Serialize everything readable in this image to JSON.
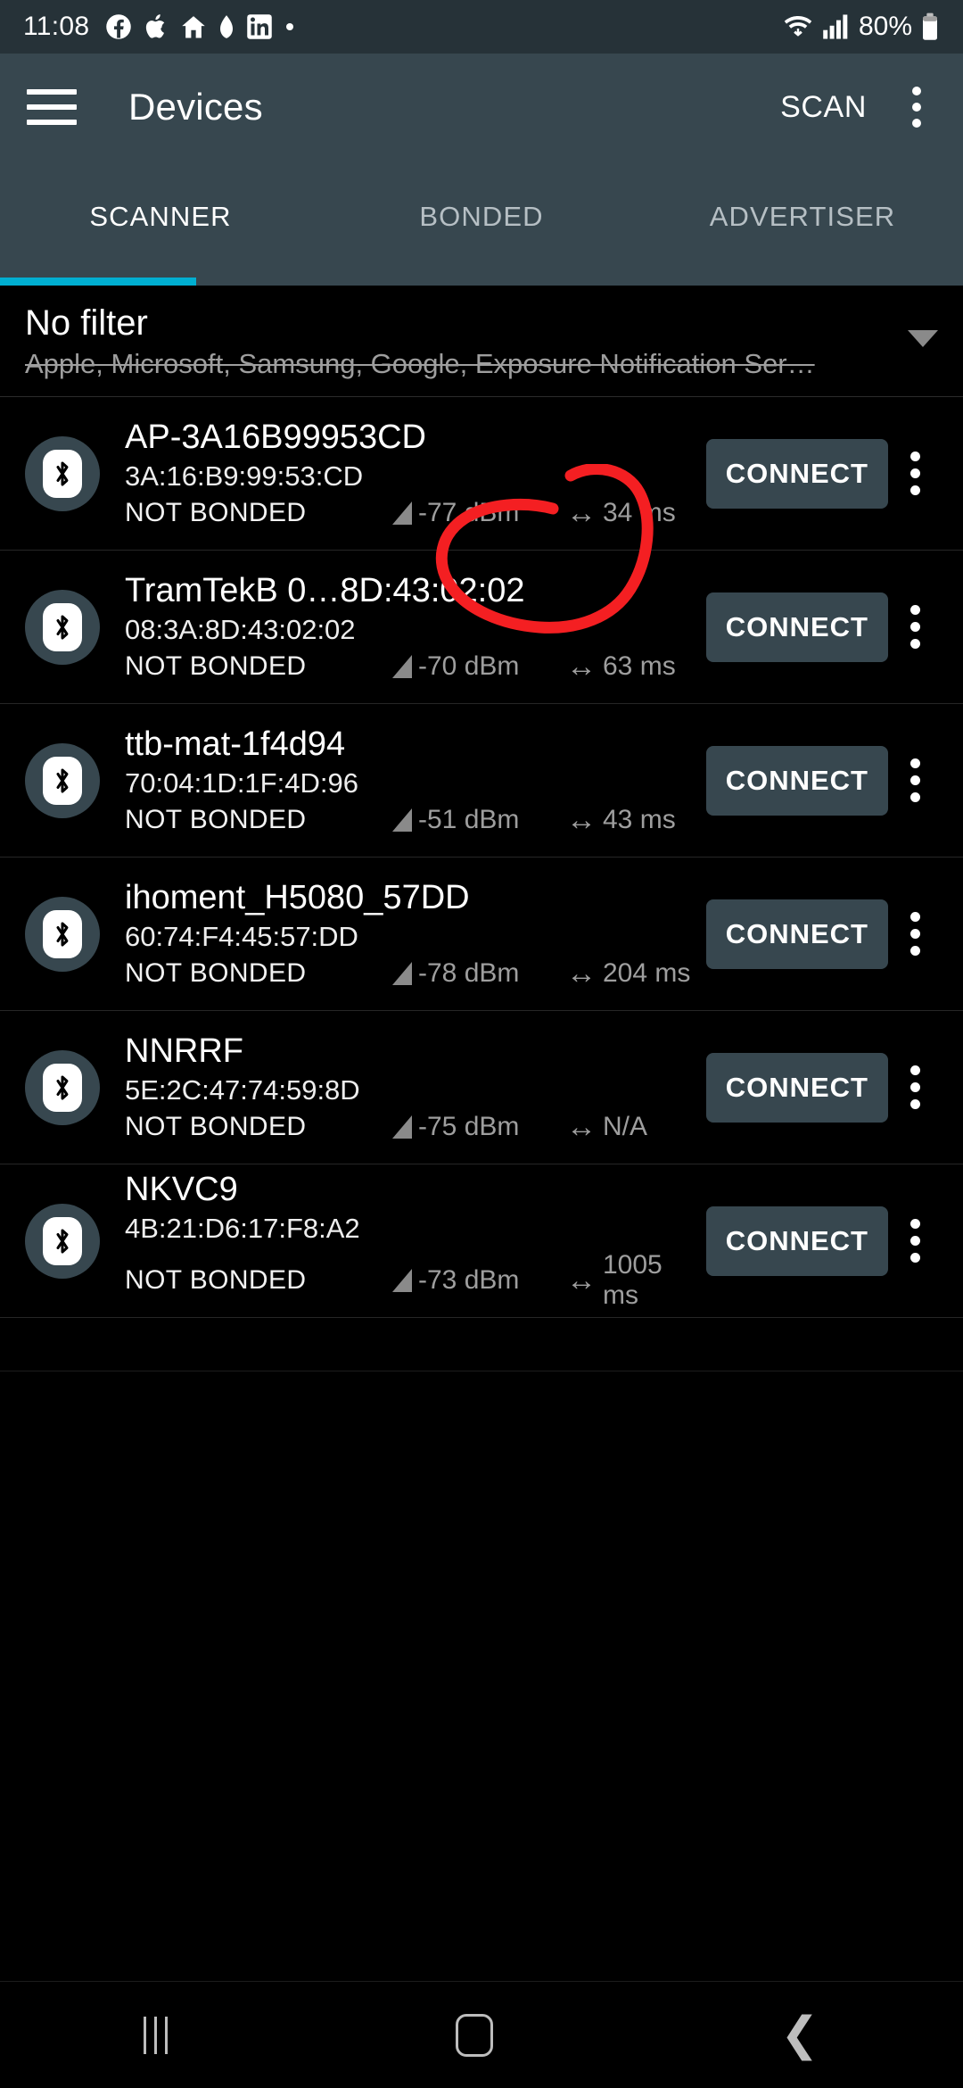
{
  "status_bar": {
    "time": "11:08",
    "left_icons": [
      "facebook-icon",
      "apple-icon",
      "home-icon",
      "leaf-icon",
      "linkedin-icon",
      "dot-icon"
    ],
    "right_icons": [
      "wifi-icon",
      "cellular-signal-icon",
      "battery-icon"
    ],
    "battery_percent": "80%",
    "background": "#263238"
  },
  "app_bar": {
    "menu_icon": "hamburger-menu-icon",
    "title": "Devices",
    "scan_label": "SCAN",
    "overflow_icon": "more-vertical-icon",
    "background": "#37474F"
  },
  "tabs": {
    "items": [
      {
        "label": "SCANNER",
        "active": true
      },
      {
        "label": "BONDED",
        "active": false
      },
      {
        "label": "ADVERTISER",
        "active": false
      }
    ],
    "indicator_color": "#00AFD1"
  },
  "filter": {
    "title": "No filter",
    "subtitle": "Apple, Microsoft, Samsung, Google, Exposure Notification Ser…",
    "caret_icon": "chevron-down-icon"
  },
  "device_list": {
    "connect_label": "CONNECT",
    "bond_status_label": "NOT BONDED",
    "device_icon": "bluetooth-icon",
    "rssi_icon": "signal-strength-icon",
    "interval_icon": "left-right-arrow-icon",
    "row_overflow_icon": "more-vertical-icon",
    "devices": [
      {
        "name": "AP-3A16B99953CD",
        "mac": "3A:16:B9:99:53:CD",
        "bond": "NOT BONDED",
        "rssi": "-77 dBm",
        "interval": "34 ms",
        "connect": "CONNECT"
      },
      {
        "name": "TramTekB 0…8D:43:02:02",
        "mac": "08:3A:8D:43:02:02",
        "bond": "NOT BONDED",
        "rssi": "-70 dBm",
        "interval": "63 ms",
        "connect": "CONNECT"
      },
      {
        "name": "ttb-mat-1f4d94",
        "mac": "70:04:1D:1F:4D:96",
        "bond": "NOT BONDED",
        "rssi": "-51 dBm",
        "interval": "43 ms",
        "connect": "CONNECT"
      },
      {
        "name": "ihoment_H5080_57DD",
        "mac": "60:74:F4:45:57:DD",
        "bond": "NOT BONDED",
        "rssi": "-78 dBm",
        "interval": "204 ms",
        "connect": "CONNECT"
      },
      {
        "name": "NNRRF",
        "mac": "5E:2C:47:74:59:8D",
        "bond": "NOT BONDED",
        "rssi": "-75 dBm",
        "interval": "N/A",
        "connect": "CONNECT"
      },
      {
        "name": "NKVC9",
        "mac": "4B:21:D6:17:F8:A2",
        "bond": "NOT BONDED",
        "rssi": "-73 dBm",
        "interval": "1005 ms",
        "connect": "CONNECT"
      }
    ]
  },
  "annotation": {
    "type": "hand-drawn-circle",
    "color": "#F41F22",
    "target": "connect-button-row-2"
  },
  "nav_bar": {
    "recents_icon": "recents-icon",
    "home_icon": "home-icon",
    "back_icon": "back-icon"
  }
}
